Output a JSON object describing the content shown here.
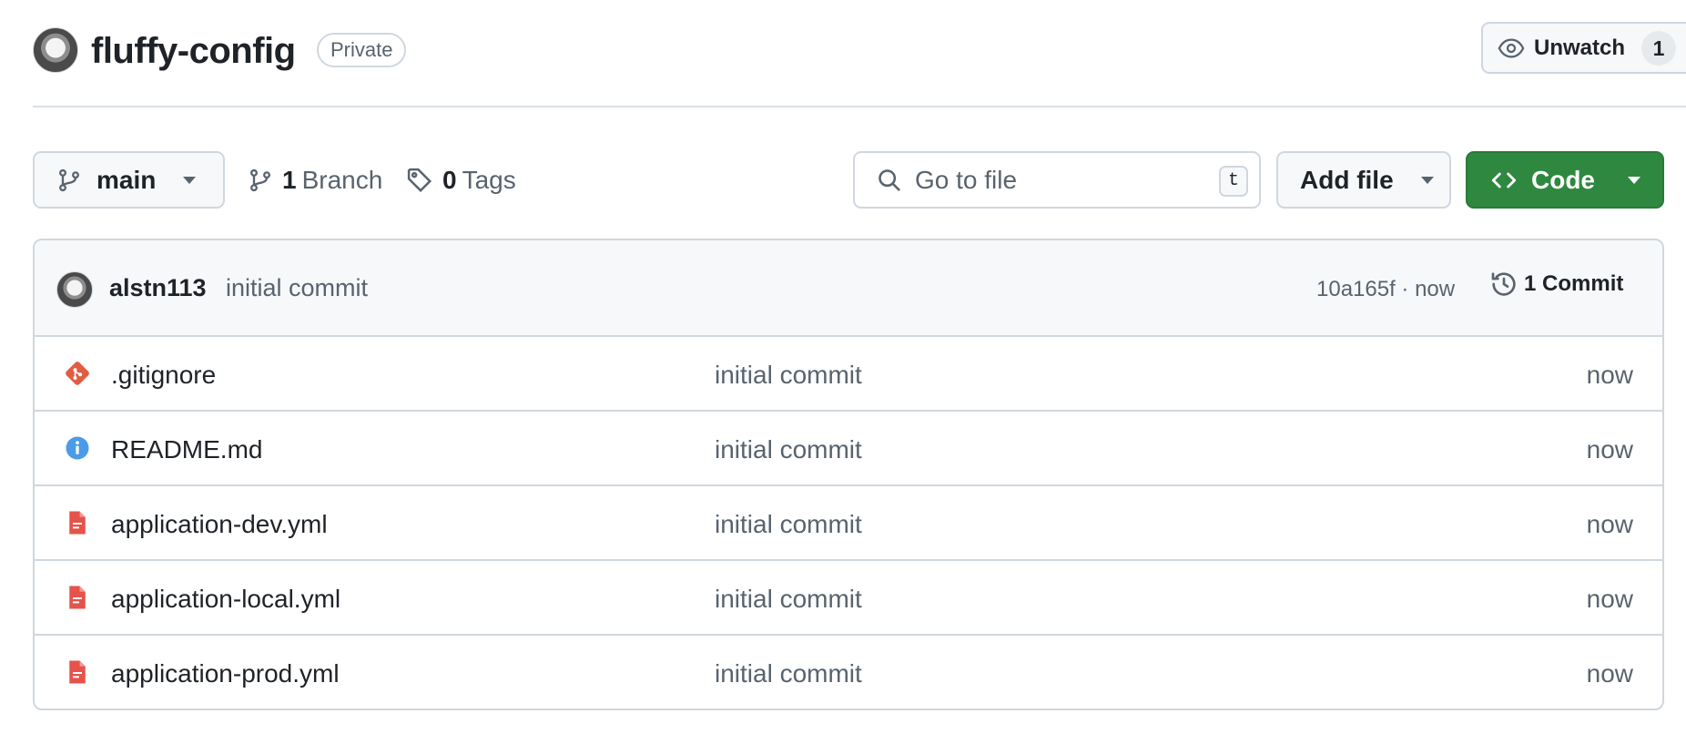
{
  "header": {
    "repo_name": "fluffy-config",
    "visibility": "Private",
    "unwatch_label": "Unwatch",
    "watch_count": "1"
  },
  "toolbar": {
    "branch": "main",
    "branch_count": "1",
    "branch_label": "Branch",
    "tag_count": "0",
    "tag_label": "Tags",
    "search_placeholder": "Go to file",
    "search_shortcut": "t",
    "add_file_label": "Add file",
    "code_label": "Code"
  },
  "latest_commit": {
    "author": "alstn113",
    "message": "initial commit",
    "sha_time": "10a165f · now",
    "commit_count_label": "1 Commit"
  },
  "files": [
    {
      "name": ".gitignore",
      "icon": "git-icon",
      "commit": "initial commit",
      "age": "now"
    },
    {
      "name": "README.md",
      "icon": "info-icon",
      "commit": "initial commit",
      "age": "now"
    },
    {
      "name": "application-dev.yml",
      "icon": "file-icon",
      "commit": "initial commit",
      "age": "now"
    },
    {
      "name": "application-local.yml",
      "icon": "file-icon",
      "commit": "initial commit",
      "age": "now"
    },
    {
      "name": "application-prod.yml",
      "icon": "file-icon",
      "commit": "initial commit",
      "age": "now"
    }
  ],
  "colors": {
    "primary_button": "#2f883f",
    "border": "#d0d7de",
    "muted_text": "#59636e",
    "git_icon": "#e05d44",
    "info_icon": "#4b9be8",
    "file_icon": "#e5534b"
  }
}
